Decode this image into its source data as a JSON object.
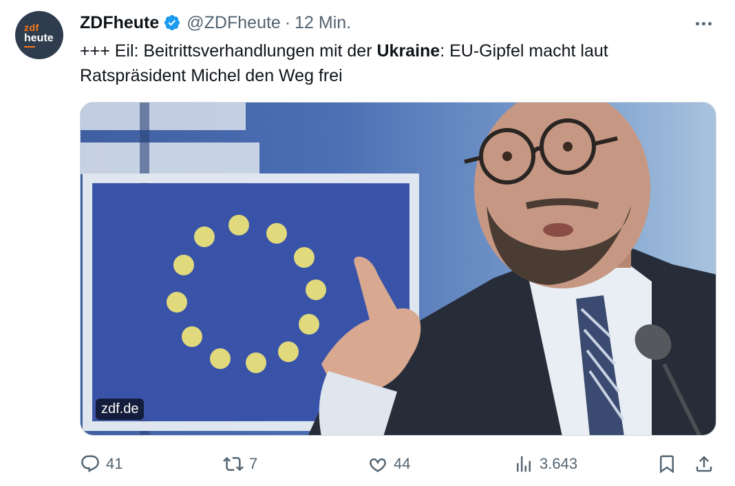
{
  "avatar": {
    "line1": "zdf",
    "line2": "heute"
  },
  "author": {
    "name": "ZDFheute",
    "handle": "@ZDFheute",
    "separator": "·",
    "time": "12 Min."
  },
  "tweet": {
    "part1": "+++ Eil: Beitrittsverhandlungen mit der ",
    "bold": "Ukraine",
    "part2": ": EU-Gipfel macht laut Ratspräsident Michel den Weg frei"
  },
  "media": {
    "badge": "zdf.de"
  },
  "metrics": {
    "replies": "41",
    "reposts": "7",
    "likes": "44",
    "views": "3.643"
  },
  "colors": {
    "verified": "#1d9bf0",
    "muted": "#536471",
    "text": "#0f1419"
  },
  "icons": [
    "verified-icon",
    "more-icon",
    "reply-icon",
    "repost-icon",
    "like-icon",
    "views-icon",
    "bookmark-icon",
    "share-icon"
  ]
}
